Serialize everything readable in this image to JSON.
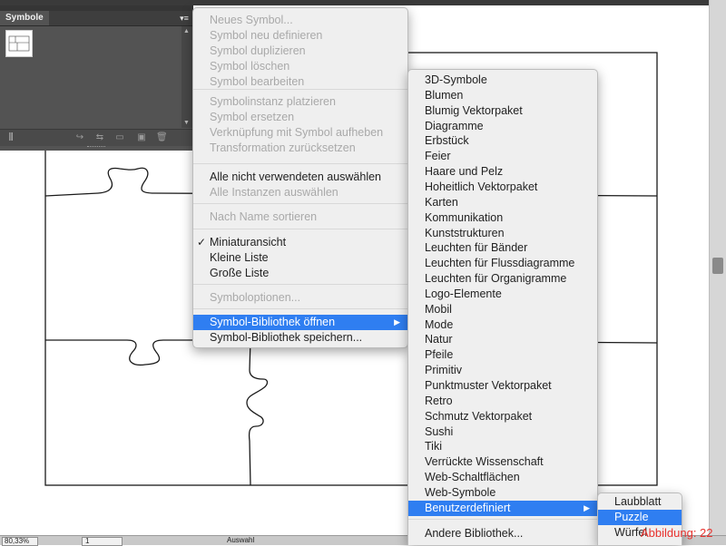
{
  "panel": {
    "tab_label": "Symbole",
    "menu_icon": "panel-menu-icon",
    "collapse_icon": "double-chevron-icon"
  },
  "status": {
    "zoom": "80,33%",
    "page": "1",
    "text": "Auswahl"
  },
  "figure_label": "Abbildung: 22",
  "main_menu": {
    "items": [
      {
        "label": "Neues Symbol...",
        "disabled": true
      },
      {
        "label": "Symbol neu definieren",
        "disabled": true
      },
      {
        "label": "Symbol duplizieren",
        "disabled": true
      },
      {
        "label": "Symbol löschen",
        "disabled": true
      },
      {
        "label": "Symbol bearbeiten",
        "disabled": true
      },
      {
        "label": "Symbolinstanz platzieren",
        "disabled": true
      },
      {
        "label": "Symbol ersetzen",
        "disabled": true
      },
      {
        "label": "Verknüpfung mit Symbol aufheben",
        "disabled": true
      },
      {
        "label": "Transformation zurücksetzen",
        "disabled": true
      },
      {
        "label": "Alle nicht verwendeten auswählen",
        "disabled": false
      },
      {
        "label": "Alle Instanzen auswählen",
        "disabled": true
      },
      {
        "label": "Nach Name sortieren",
        "disabled": true
      },
      {
        "label": "Miniaturansicht",
        "disabled": false,
        "checked": true
      },
      {
        "label": "Kleine Liste",
        "disabled": false
      },
      {
        "label": "Große Liste",
        "disabled": false
      },
      {
        "label": "Symboloptionen...",
        "disabled": true
      },
      {
        "label": "Symbol-Bibliothek öffnen",
        "disabled": false,
        "highlighted": true,
        "submenu": true
      },
      {
        "label": "Symbol-Bibliothek speichern...",
        "disabled": false
      }
    ]
  },
  "library_menu": {
    "items": [
      "3D-Symbole",
      "Blumen",
      "Blumig Vektorpaket",
      "Diagramme",
      "Erbstück",
      "Feier",
      "Haare und Pelz",
      "Hoheitlich Vektorpaket",
      "Karten",
      "Kommunikation",
      "Kunststrukturen",
      "Leuchten für Bänder",
      "Leuchten für Flussdiagramme",
      "Leuchten für Organigramme",
      "Logo-Elemente",
      "Mobil",
      "Mode",
      "Natur",
      "Pfeile",
      "Primitiv",
      "Punktmuster Vektorpaket",
      "Retro",
      "Schmutz Vektorpaket",
      "Sushi",
      "Tiki",
      "Verrückte Wissenschaft",
      "Web-Schaltflächen",
      "Web-Symbole",
      "Benutzerdefiniert"
    ],
    "highlighted": "Benutzerdefiniert",
    "other": "Andere Bibliothek..."
  },
  "custom_menu": {
    "items": [
      "Laubblatt",
      "Puzzle",
      "Würfel"
    ],
    "highlighted": "Puzzle"
  },
  "colors": {
    "highlight": "#2f7ef1",
    "figure_label": "#e8322e",
    "panel": "#535353"
  }
}
